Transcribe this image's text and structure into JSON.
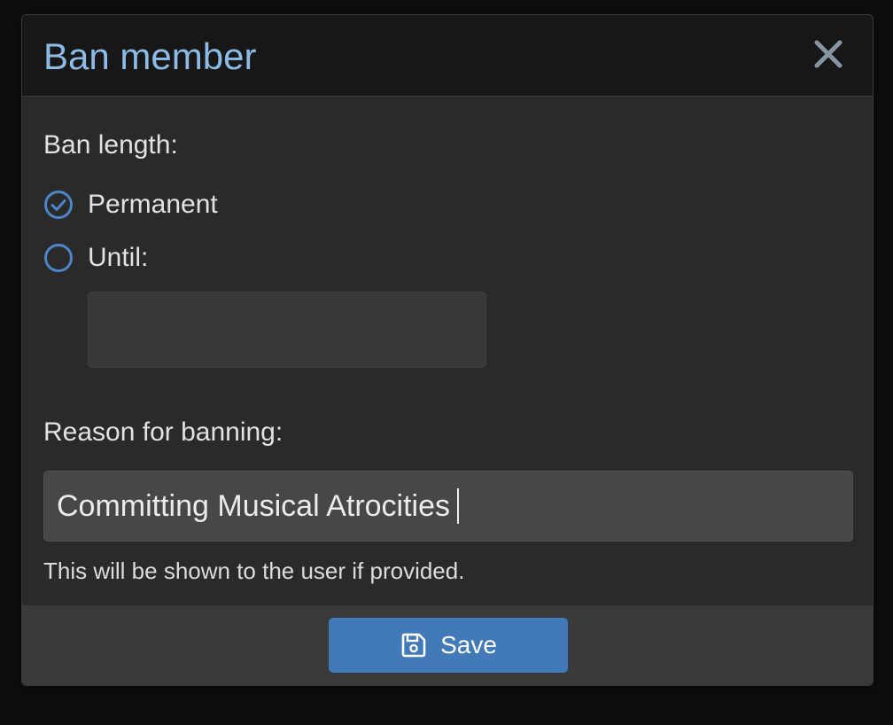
{
  "dialog": {
    "title": "Ban member",
    "close_icon": "close-icon"
  },
  "ban_length": {
    "label": "Ban length:",
    "options": [
      {
        "label": "Permanent",
        "selected": true
      },
      {
        "label": "Until:",
        "selected": false
      }
    ],
    "until_value": ""
  },
  "reason": {
    "label": "Reason for banning:",
    "value": "Committing Musical Atrocities",
    "hint": "This will be shown to the user if provided."
  },
  "footer": {
    "save_label": "Save",
    "save_icon": "save-icon"
  },
  "colors": {
    "title": "#8cbbe6",
    "accent": "#4279b8",
    "radio": "#4a86c8",
    "body_bg": "#2a2a2a",
    "header_bg": "#171717",
    "footer_bg": "#3a3a3a"
  }
}
